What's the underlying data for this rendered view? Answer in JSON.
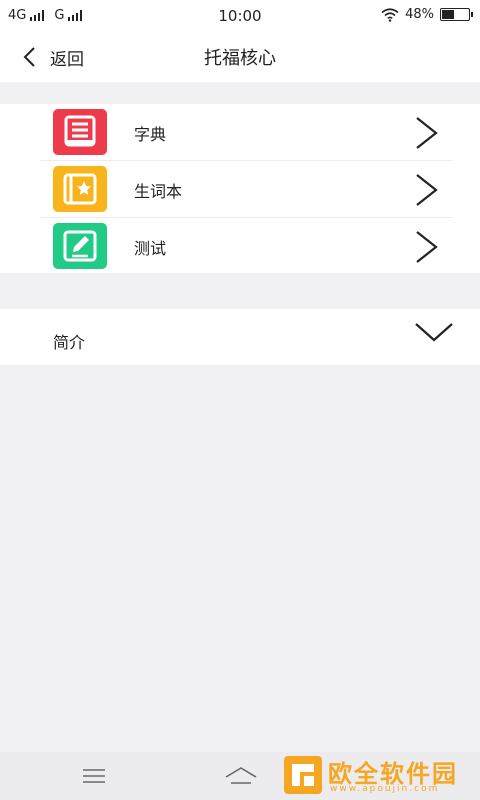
{
  "status_bar": {
    "network_1": "4G",
    "network_2": "G",
    "time": "10:00",
    "battery_percent": "48%",
    "battery_level": 0.48,
    "icons": [
      "signal-icon",
      "wifi-icon",
      "battery-icon"
    ]
  },
  "nav": {
    "back_label": "返回",
    "title": "托福核心"
  },
  "menu": {
    "items": [
      {
        "label": "字典",
        "icon": "dictionary-icon",
        "color": "#ee3b4c"
      },
      {
        "label": "生词本",
        "icon": "notebook-star-icon",
        "color": "#f8b51b"
      },
      {
        "label": "测试",
        "icon": "edit-test-icon",
        "color": "#21cb86"
      }
    ]
  },
  "intro": {
    "label": "简介",
    "expanded": false
  },
  "bottom_nav": {
    "icons": [
      "menu-icon",
      "home-icon"
    ]
  },
  "watermark": {
    "title": "欧全软件园",
    "url": "www.apoujin.com",
    "color": "#f5a623"
  }
}
